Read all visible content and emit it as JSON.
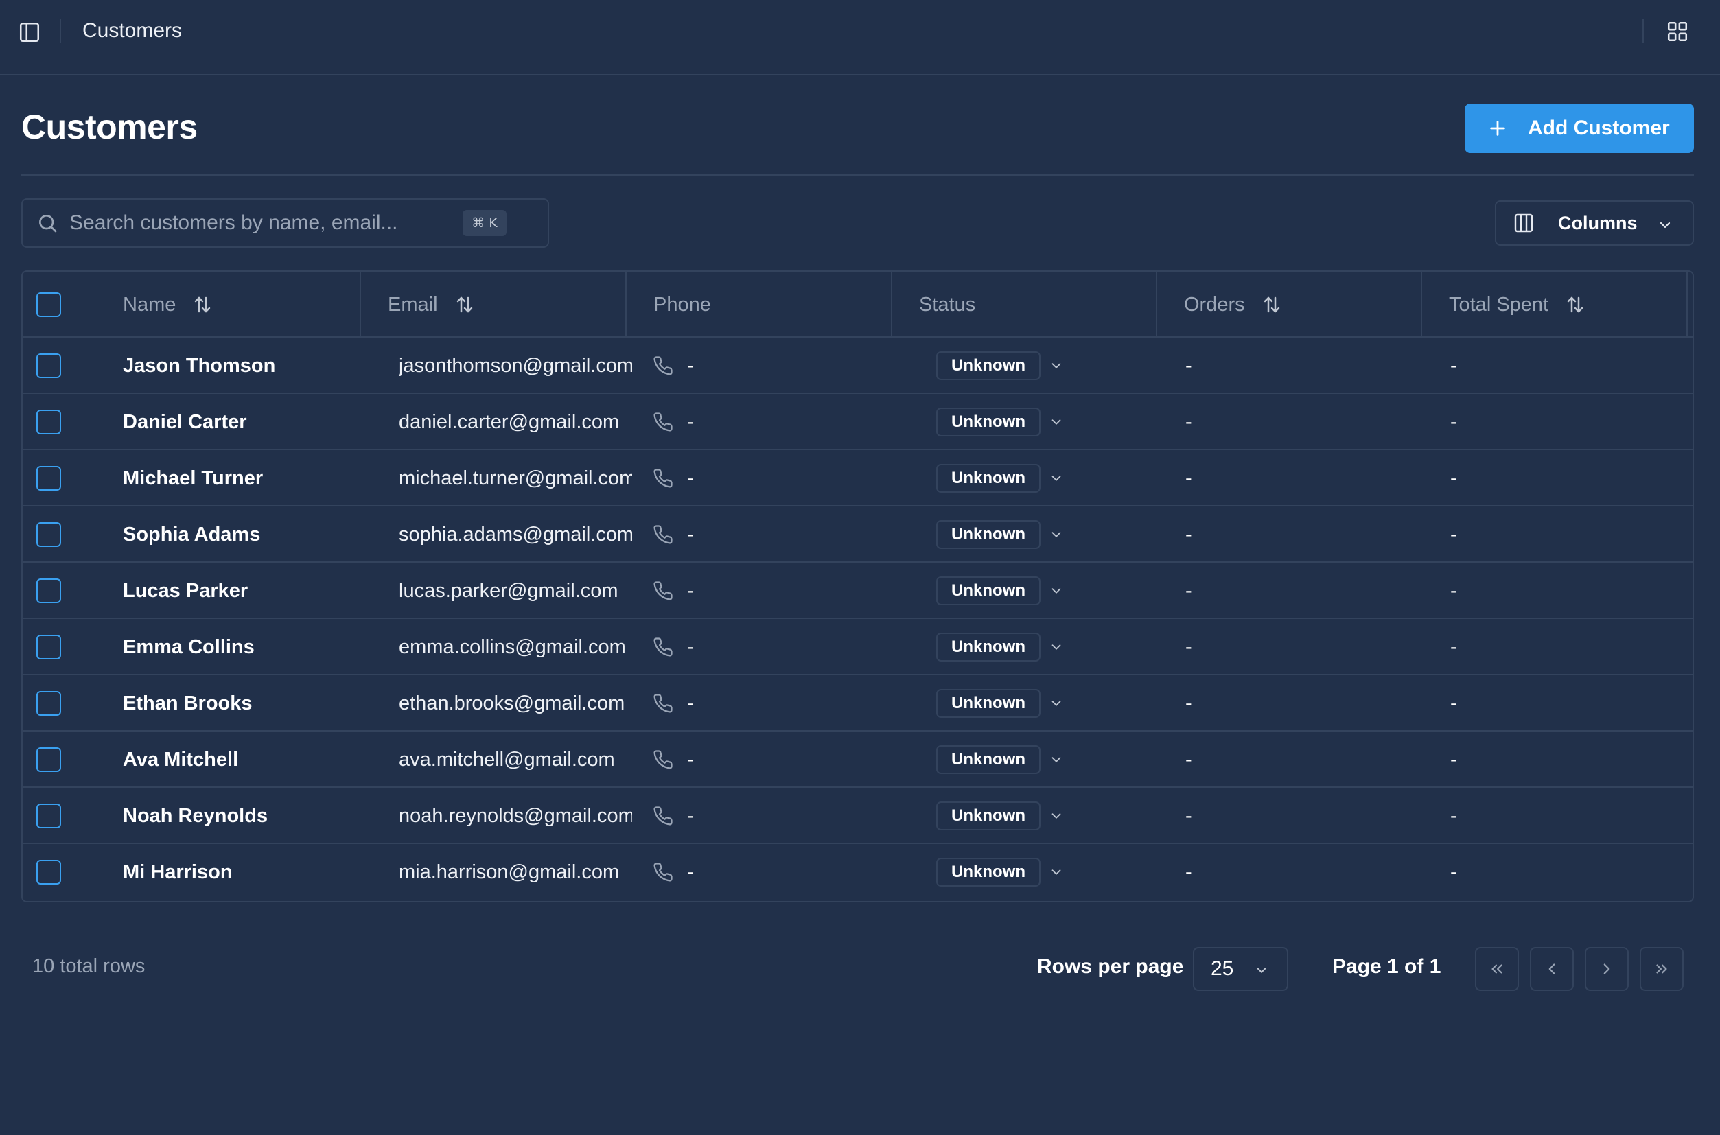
{
  "topbar": {
    "title": "Customers",
    "sidebar_toggle_icon": "sidebar-toggle-icon",
    "apps_icon": "grid-icon"
  },
  "header": {
    "title": "Customers",
    "add_button_label": "Add Customer",
    "add_icon": "plus-icon",
    "accent_color": "#2f95e8"
  },
  "search": {
    "placeholder": "Search customers by name, email...",
    "value": "",
    "shortcut": "⌘ K"
  },
  "columns_button": {
    "label": "Columns"
  },
  "table": {
    "columns": [
      "Name",
      "Email",
      "Phone",
      "Status",
      "Orders",
      "Total Spent"
    ],
    "rows": [
      {
        "name": "Jason Thomson",
        "email": "jasonthomson@gmail.com",
        "phone": "-",
        "status": "Unknown",
        "orders": "-",
        "total_spent": "-"
      },
      {
        "name": "Daniel Carter",
        "email": "daniel.carter@gmail.com",
        "phone": "-",
        "status": "Unknown",
        "orders": "-",
        "total_spent": "-"
      },
      {
        "name": "Michael Turner",
        "email": "michael.turner@gmail.com",
        "phone": "-",
        "status": "Unknown",
        "orders": "-",
        "total_spent": "-"
      },
      {
        "name": "Sophia Adams",
        "email": "sophia.adams@gmail.com",
        "phone": "-",
        "status": "Unknown",
        "orders": "-",
        "total_spent": "-"
      },
      {
        "name": "Lucas Parker",
        "email": "lucas.parker@gmail.com",
        "phone": "-",
        "status": "Unknown",
        "orders": "-",
        "total_spent": "-"
      },
      {
        "name": "Emma Collins",
        "email": "emma.collins@gmail.com",
        "phone": "-",
        "status": "Unknown",
        "orders": "-",
        "total_spent": "-"
      },
      {
        "name": "Ethan Brooks",
        "email": "ethan.brooks@gmail.com",
        "phone": "-",
        "status": "Unknown",
        "orders": "-",
        "total_spent": "-"
      },
      {
        "name": "Ava Mitchell",
        "email": "ava.mitchell@gmail.com",
        "phone": "-",
        "status": "Unknown",
        "orders": "-",
        "total_spent": "-"
      },
      {
        "name": "Noah Reynolds",
        "email": "noah.reynolds@gmail.com",
        "phone": "-",
        "status": "Unknown",
        "orders": "-",
        "total_spent": "-"
      },
      {
        "name": "Mi Harrison",
        "email": "mia.harrison@gmail.com",
        "phone": "-",
        "status": "Unknown",
        "orders": "-",
        "total_spent": "-"
      }
    ]
  },
  "footer": {
    "total_rows": "10 total rows",
    "rows_per_page_label": "Rows per page",
    "rows_per_page_value": "25",
    "page_label": "Page 1 of 1"
  }
}
